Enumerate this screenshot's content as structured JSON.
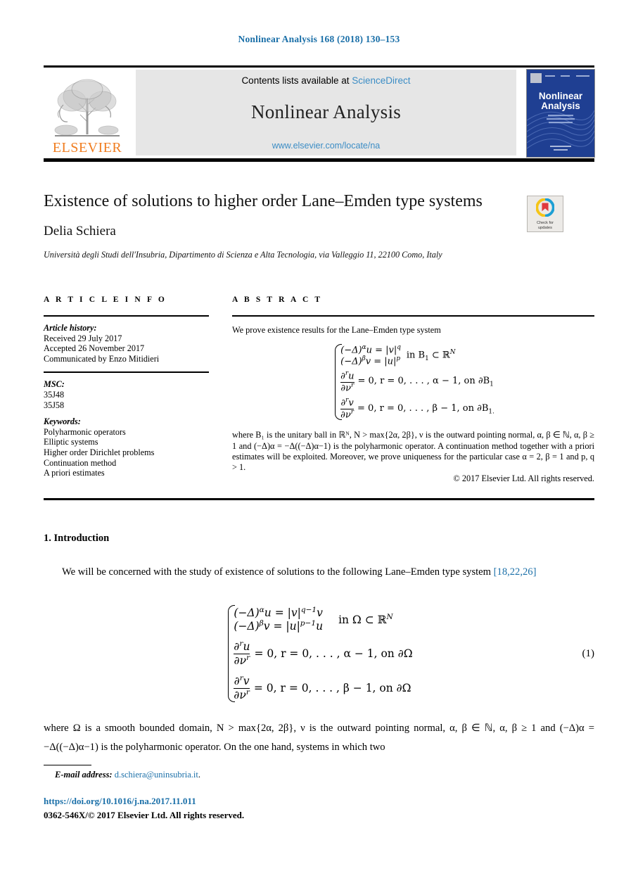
{
  "running_head": "Nonlinear Analysis 168 (2018) 130–153",
  "masthead": {
    "contents_prefix": "Contents lists available at ",
    "sciencedirect": "ScienceDirect",
    "journal_name": "Nonlinear Analysis",
    "journal_url": "www.elsevier.com/locate/na",
    "publisher_logo_text": "ELSEVIER",
    "cover_title_line1": "Nonlinear",
    "cover_title_line2": "Analysis"
  },
  "crossmark": {
    "label_line1": "Check for",
    "label_line2": "updates"
  },
  "article": {
    "title": "Existence of solutions to higher order Lane–Emden type systems",
    "author": "Delia Schiera",
    "affiliation": "Università degli Studi dell'Insubria, Dipartimento di Scienza e Alta Tecnologia, via Valleggio 11, 22100 Como, Italy"
  },
  "info": {
    "heading": "A R T I C L E   I N F O",
    "history_label": "Article history:",
    "history": [
      "Received 29 July 2017",
      "Accepted 26 November 2017",
      "Communicated by Enzo Mitidieri"
    ],
    "msc_label": "MSC:",
    "msc": [
      "35J48",
      "35J58"
    ],
    "keywords_label": "Keywords:",
    "keywords": [
      "Polyharmonic operators",
      "Elliptic systems",
      "Higher order Dirichlet problems",
      "Continuation method",
      "A priori estimates"
    ]
  },
  "abstract": {
    "heading": "A B S T R A C T",
    "intro": "We prove existence results for the Lane–Emden type system",
    "equation": {
      "row1_lhs": "(−Δ)",
      "row1_sup": "α",
      "row1_mid": "u = |v|",
      "row1_sup2": "q",
      "row2_lhs": "(−Δ)",
      "row2_sup": "β",
      "row2_mid": "v = |u|",
      "row2_sup2": "p",
      "domain": "in B",
      "domain_sub": "1",
      "domain_rest": " ⊂ ℝ",
      "domain_sup": "N",
      "row3_num": "∂",
      "row3_num_sup": "r",
      "row3_num_var": "u",
      "row3_den": "∂ν",
      "row3_den_sup": "r",
      "row3_rest": "= 0, r = 0, . . . , α − 1,  on ∂B",
      "row3_rest_sub": "1",
      "row4_num_var": "v",
      "row4_rest": "= 0, r = 0, . . . , β − 1,  on ∂B",
      "row4_rest_sub": "1."
    },
    "body": "where B₁ is the unitary ball in ℝᴺ, N > max{2α, 2β}, ν is the outward pointing normal, α, β ∈ ℕ, α, β ≥ 1 and (−Δ)α = −Δ((−Δ)α−1) is the polyharmonic operator. A continuation method together with a priori estimates will be exploited. Moreover, we prove uniqueness for the particular case α = 2, β = 1 and p, q > 1.",
    "copyright": "© 2017 Elsevier Ltd. All rights reserved."
  },
  "introduction": {
    "heading": "1. Introduction",
    "para_part1": "We will be concerned with the study of existence of solutions to the following Lane–Emden type system ",
    "citation": "[18,22,26]",
    "equation_number": "(1)",
    "equation": {
      "row1_lhs": "(−Δ)",
      "row1_sup": "α",
      "row1_mid": "u = |v|",
      "row1_sup2": "q−1",
      "row1_tail": "v",
      "row2_lhs": "(−Δ)",
      "row2_sup": "β",
      "row2_mid": "v = |u|",
      "row2_sup2": "p−1",
      "row2_tail": "u",
      "domain": "in Ω ⊂ ℝ",
      "domain_sup": "N",
      "row3_num": "∂",
      "row3_num_sup": "r",
      "row3_num_var": "u",
      "row3_den": "∂ν",
      "row3_den_sup": "r",
      "row3_rest": "= 0, r = 0, . . . , α − 1,  on ∂Ω",
      "row4_num_var": "v",
      "row4_rest": "= 0, r = 0, . . . , β − 1,  on ∂Ω"
    },
    "after_equation": "where Ω is a smooth bounded domain, N > max{2α, 2β}, ν is the outward pointing normal, α, β ∈ ℕ, α, β ≥ 1 and (−Δ)α = −Δ((−Δ)α−1) is the polyharmonic operator. On the one hand, systems in which two"
  },
  "footer": {
    "email_label": "E-mail address:",
    "email": "d.schiera@uninsubria.it",
    "email_period": ".",
    "doi": "https://doi.org/10.1016/j.na.2017.11.011",
    "issn": "0362-546X/© 2017 Elsevier Ltd. All rights reserved."
  },
  "colors": {
    "link": "#1a6fa8",
    "sciencedirect": "#3c8dc5",
    "elsevier_orange": "#f07d20",
    "cover_blue": "#1c3b8c"
  }
}
